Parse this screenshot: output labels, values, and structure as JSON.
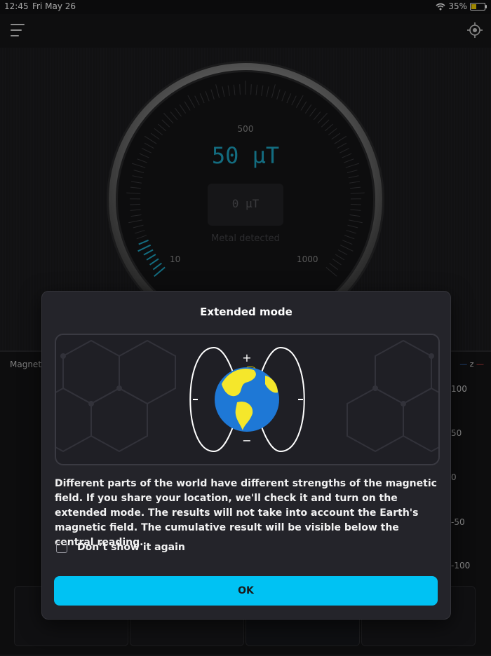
{
  "status_bar": {
    "time": "12:45",
    "date": "Fri May 26",
    "battery": "35%"
  },
  "gauge": {
    "top_scale_label": "500",
    "reading": "50 µT",
    "secondary_reading": "0 µT",
    "metal_status": "Metal detected",
    "left_scale_label": "10",
    "right_scale_label": "1000",
    "accent_color": "#1ea7c5"
  },
  "graph": {
    "title_partial": "Magnet",
    "legend_label": "z",
    "y_labels": [
      "100",
      "50",
      "0",
      "-50",
      "-100"
    ]
  },
  "dialog": {
    "title": "Extended mode",
    "illustration": {
      "plus_sign": "+",
      "minus_sign": "−"
    },
    "body": "Different parts of the world have different strengths of the magnetic field. If you share your location, we'll check it and turn on the extended mode. The results will not take into account the Earth's magnetic field. The cumulative result will be visible below the central reading.",
    "checkbox_label": "Don’t show it again",
    "ok_label": "OK",
    "accent_color": "#00c2f3"
  },
  "icons": [
    "menu-icon",
    "locate-icon",
    "wifi-icon",
    "battery-icon",
    "globe-icon"
  ]
}
